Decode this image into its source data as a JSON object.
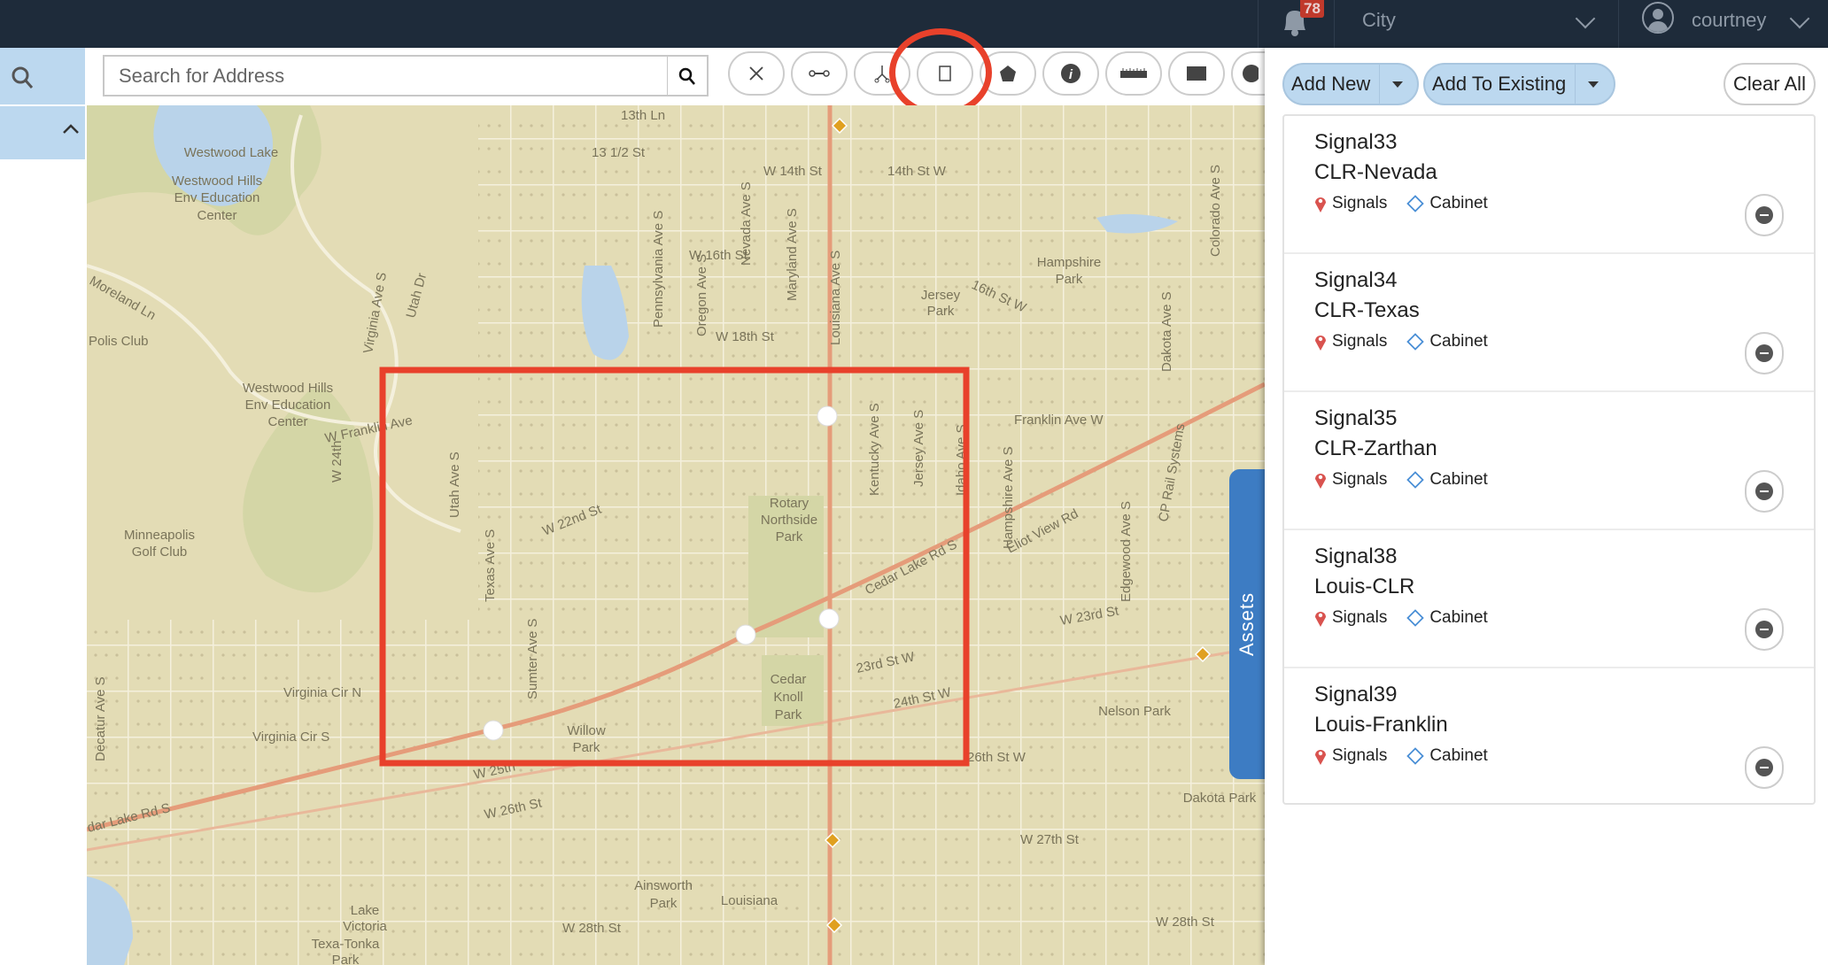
{
  "topbar": {
    "notifications_count": "78",
    "org_selector": "City",
    "username": "courtney"
  },
  "search": {
    "placeholder": "Search for Address"
  },
  "toolbar": {
    "tools": [
      "clear-tool",
      "line-tool",
      "trace-tool",
      "rectangle-select-tool",
      "polygon-tool",
      "info-tool",
      "measure-tool",
      "fill-tool",
      "circle-tool"
    ],
    "active_tool": "rectangle-select-tool"
  },
  "map": {
    "labels": [
      "13th Ln",
      "13 1/2 St",
      "W 14th St",
      "14th St W",
      "Westwood Lake",
      "Westwood Hills",
      "Env Education",
      "Center",
      "W 16th St",
      "W 18th St",
      "16th St W",
      "Hampshire",
      "Park",
      "Jersey",
      "Park",
      "Westwood Hills",
      "Env Education",
      "Center",
      "W Franklin Ave",
      "Franklin Ave W",
      "Minneapolis",
      "Golf Club",
      "Rotary",
      "Northside",
      "Park",
      "W 22nd St",
      "Cedar Lake Rd S",
      "Eliot View Rd",
      "W 23rd St",
      "23rd St W",
      "24th St W",
      "Cedar",
      "Knoll",
      "Park",
      "Willow",
      "Park",
      "Virginia Cir N",
      "Virginia Cir S",
      "Nelson Park",
      "26th St W",
      "W 25th",
      "W 26th St",
      "Dakota Park",
      "W 27th St",
      "Ainsworth",
      "Park",
      "Louisiana",
      "W 28th St",
      "W 28th St",
      "Lake",
      "Victoria",
      "Texa-Tonka",
      "Park",
      "Louisiana Ave S",
      "Pennsylvania Ave S",
      "Oregon Ave S",
      "Nevada Ave S",
      "Maryland Ave S",
      "Kentucky Ave S",
      "Jersey Ave S",
      "Idaho Ave S",
      "Hampshire Ave S",
      "Utah Dr",
      "Virginia Ave S",
      "Texas Ave S",
      "Utah Ave S",
      "Sumter Ave S",
      "Decatur Ave S",
      "Edgewood Ave S",
      "Dakota Ave S",
      "Colorado Ave S",
      "CP Rail Systems",
      "W 24th",
      "Moreland Ln",
      "Polis Club",
      "dar Lake Rd S"
    ],
    "selection_color": "#e8412b"
  },
  "assets_tab": {
    "label": "Assets"
  },
  "panel": {
    "add_new": "Add New",
    "add_existing": "Add To Existing",
    "clear_all": "Clear All",
    "items": [
      {
        "id": "Signal33",
        "name": "CLR-Nevada",
        "layer": "Signals",
        "type": "Cabinet"
      },
      {
        "id": "Signal34",
        "name": "CLR-Texas",
        "layer": "Signals",
        "type": "Cabinet"
      },
      {
        "id": "Signal35",
        "name": "CLR-Zarthan",
        "layer": "Signals",
        "type": "Cabinet"
      },
      {
        "id": "Signal38",
        "name": "Louis-CLR",
        "layer": "Signals",
        "type": "Cabinet"
      },
      {
        "id": "Signal39",
        "name": "Louis-Franklin",
        "layer": "Signals",
        "type": "Cabinet"
      }
    ]
  },
  "colors": {
    "topbar": "#1e2b3a",
    "accent_blue": "#3d7cc3",
    "button_blue": "#bcd8ef",
    "highlight_red": "#e8412b"
  }
}
